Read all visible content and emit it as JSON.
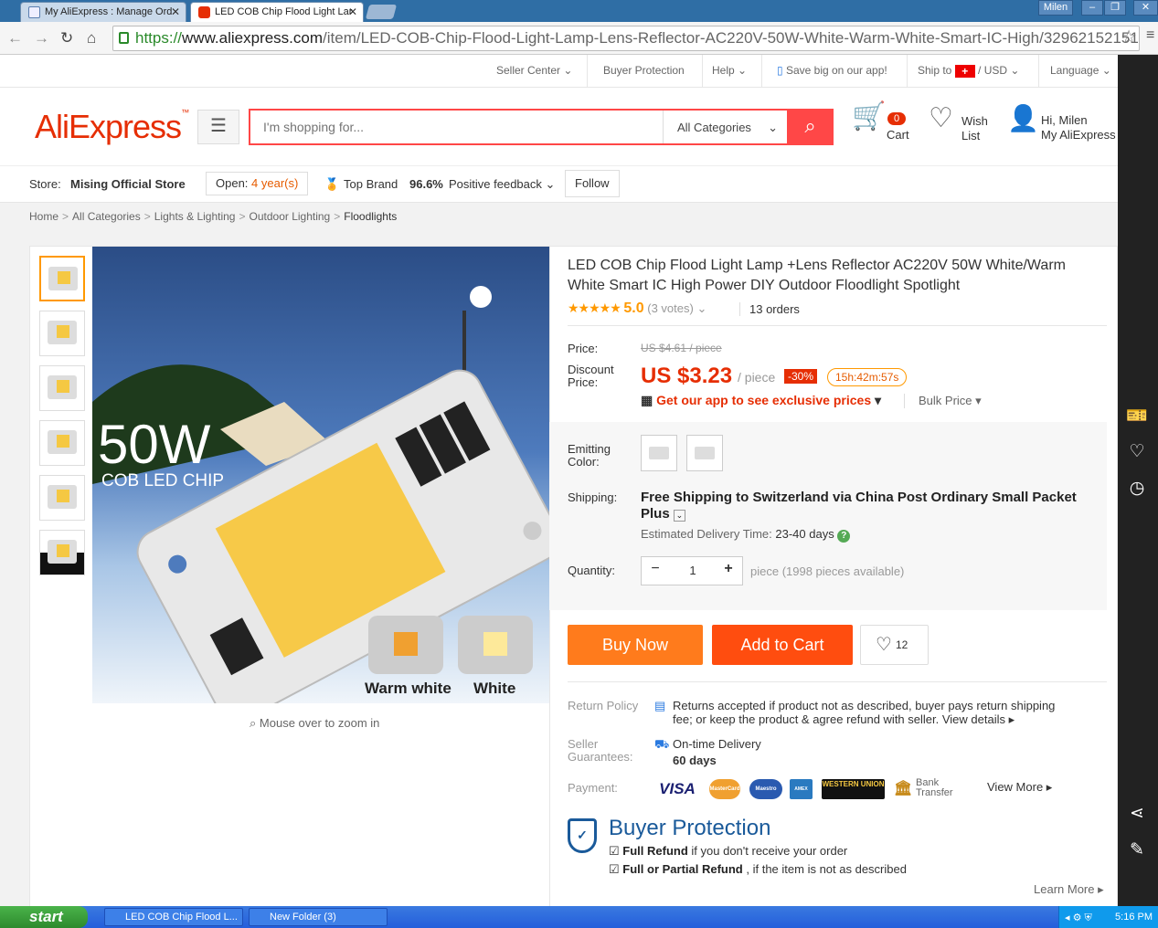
{
  "browser": {
    "tabs": [
      {
        "title": "My AliExpress : Manage Ord"
      },
      {
        "title": "LED COB Chip Flood Light Lar"
      }
    ],
    "user": "Milen",
    "url_scheme": "https://",
    "url_host": "www.aliexpress.com",
    "url_path": "/item/LED-COB-Chip-Flood-Light-Lamp-Lens-Reflector-AC220V-50W-White-Warm-White-Smart-IC-High/32962152151.html"
  },
  "topnav": {
    "seller_center": "Seller Center",
    "buyer_protection": "Buyer Protection",
    "help": "Help",
    "app": "Save big on our app!",
    "ship_to": "Ship to",
    "currency": "USD",
    "language": "Language"
  },
  "header": {
    "logo": "AliExpress",
    "search_placeholder": "I'm shopping for...",
    "search_category": "All Categories",
    "cart_count": "0",
    "cart_label": "Cart",
    "wish_line1": "Wish",
    "wish_line2": "List",
    "greeting": "Hi, Milen",
    "my_account": "My AliExpress"
  },
  "store": {
    "label": "Store:",
    "name": "Mising Official Store",
    "open_label": "Open:",
    "open_years": "4 year(s)",
    "top_brand": "Top Brand",
    "feedback_pct": "96.6%",
    "feedback_label": "Positive feedback",
    "follow": "Follow"
  },
  "breadcrumb": [
    "Home",
    "All Categories",
    "Lights & Lighting",
    "Outdoor Lighting",
    "Floodlights"
  ],
  "gallery": {
    "main_text": "50W",
    "main_sub": "COB LED CHIP",
    "label_warm": "Warm white",
    "label_white": "White",
    "zoom_hint": "Mouse over to zoom in"
  },
  "product": {
    "title": "LED COB Chip Flood Light Lamp +Lens Reflector AC220V 50W White/Warm White Smart IC High Power DIY Outdoor Floodlight Spotlight",
    "rating": "5.0",
    "votes": "(3 votes)",
    "orders": "13 orders",
    "price_label": "Price:",
    "original_price": "US $4.61 / piece",
    "discount_label_1": "Discount",
    "discount_label_2": "Price:",
    "price": "US $3.23",
    "per_piece": "/ piece",
    "discount": "-30%",
    "timer": "15h:42m:57s",
    "app_price": "Get our app to see exclusive prices",
    "bulk_price": "Bulk Price",
    "color_label_1": "Emitting",
    "color_label_2": "Color:",
    "shipping_label": "Shipping:",
    "shipping": "Free Shipping to Switzerland via China Post Ordinary Small Packet Plus",
    "est_label": "Estimated Delivery Time:",
    "est_days": "23-40 days",
    "quantity_label": "Quantity:",
    "quantity": "1",
    "availability": "piece (1998 pieces available)",
    "buy_now": "Buy Now",
    "add_to_cart": "Add to Cart",
    "wish_count": "12",
    "return_label": "Return Policy",
    "return_text_1": "Returns accepted if product not as described, buyer pays return shipping",
    "return_text_2": "fee; or keep the product & agree refund with seller.",
    "view_details": "View details",
    "guarantee_label_1": "Seller",
    "guarantee_label_2": "Guarantees:",
    "ontime": "On-time Delivery",
    "ontime_days": "60 days",
    "payment_label": "Payment:",
    "payments": [
      "VISA",
      "MasterCard",
      "Maestro",
      "AMEX",
      "WESTERN UNION"
    ],
    "bank_1": "Bank",
    "bank_2": "Transfer",
    "view_more": "View More",
    "bp_title": "Buyer Protection",
    "bp_1_bold": "Full Refund",
    "bp_1_rest": "if you don't receive your order",
    "bp_2_bold": "Full or Partial Refund",
    "bp_2_rest": ", if the item is not as described",
    "learn_more": "Learn More"
  },
  "taskbar": {
    "start": "start",
    "task1": "LED COB Chip Flood L...",
    "task2": "New Folder (3)",
    "clock": "5:16 PM"
  },
  "colors": {
    "accent": "#e62e04",
    "buy": "#ff7b1c",
    "cart": "#ff4d0f",
    "bp": "#1a5a9a"
  }
}
